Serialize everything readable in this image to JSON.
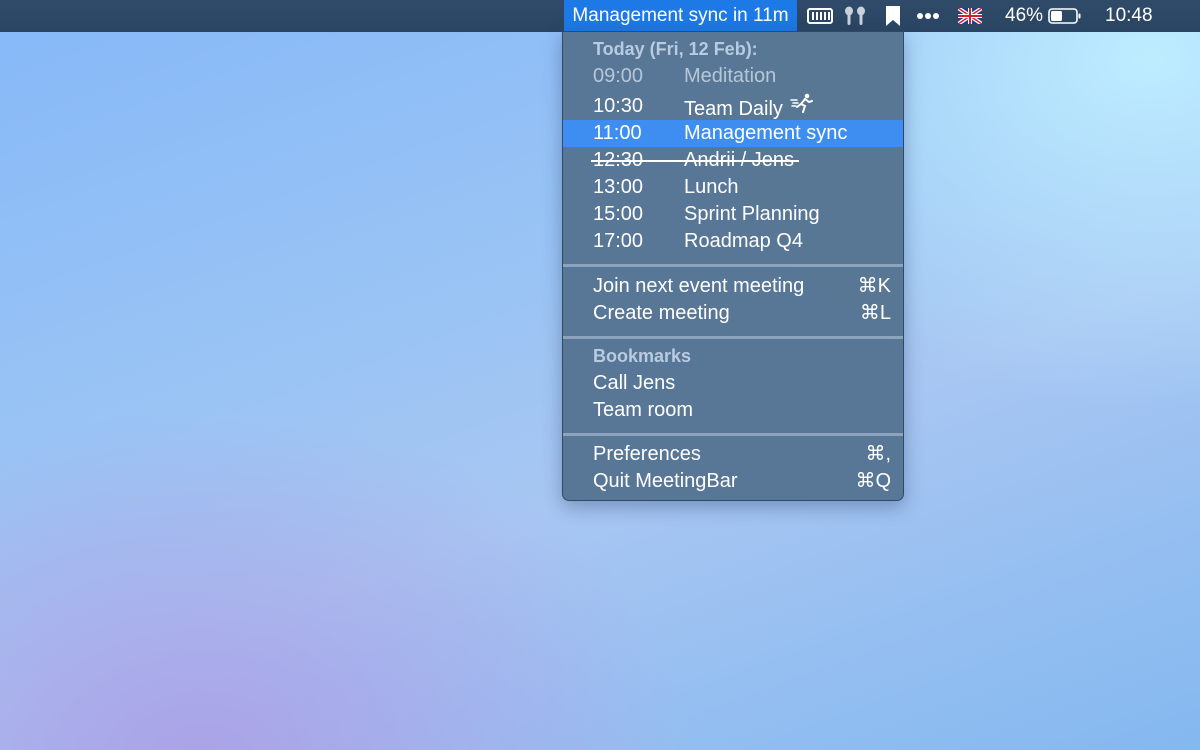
{
  "menubar": {
    "active_item": "Management sync in 11m",
    "battery_percent": "46%",
    "battery_level": 0.46,
    "clock": "10:48",
    "icons": [
      "battery-strip-icon",
      "airpods-icon",
      "bookmark-icon",
      "more-dots-icon",
      "uk-flag-icon",
      "battery-icon"
    ]
  },
  "menu": {
    "today_header": "Today (Fri, 12 Feb):",
    "events": [
      {
        "time": "09:00",
        "title": "Meditation",
        "state": "past"
      },
      {
        "time": "10:30",
        "title": "Team Daily",
        "state": "ongoing",
        "icon": "running-person-icon"
      },
      {
        "time": "11:00",
        "title": "Management sync",
        "state": "selected"
      },
      {
        "time": "12:30",
        "title": "Andrii / Jens",
        "state": "declined"
      },
      {
        "time": "13:00",
        "title": "Lunch",
        "state": "upcoming"
      },
      {
        "time": "15:00",
        "title": "Sprint Planning",
        "state": "upcoming"
      },
      {
        "time": "17:00",
        "title": "Roadmap Q4",
        "state": "upcoming"
      }
    ],
    "actions": [
      {
        "label": "Join next event meeting",
        "shortcut": "⌘K"
      },
      {
        "label": "Create meeting",
        "shortcut": "⌘L"
      }
    ],
    "bookmarks_header": "Bookmarks",
    "bookmarks": [
      "Call Jens",
      "Team room"
    ],
    "app_items": [
      {
        "label": "Preferences",
        "shortcut": "⌘,"
      },
      {
        "label": "Quit MeetingBar",
        "shortcut": "⌘Q"
      }
    ]
  }
}
